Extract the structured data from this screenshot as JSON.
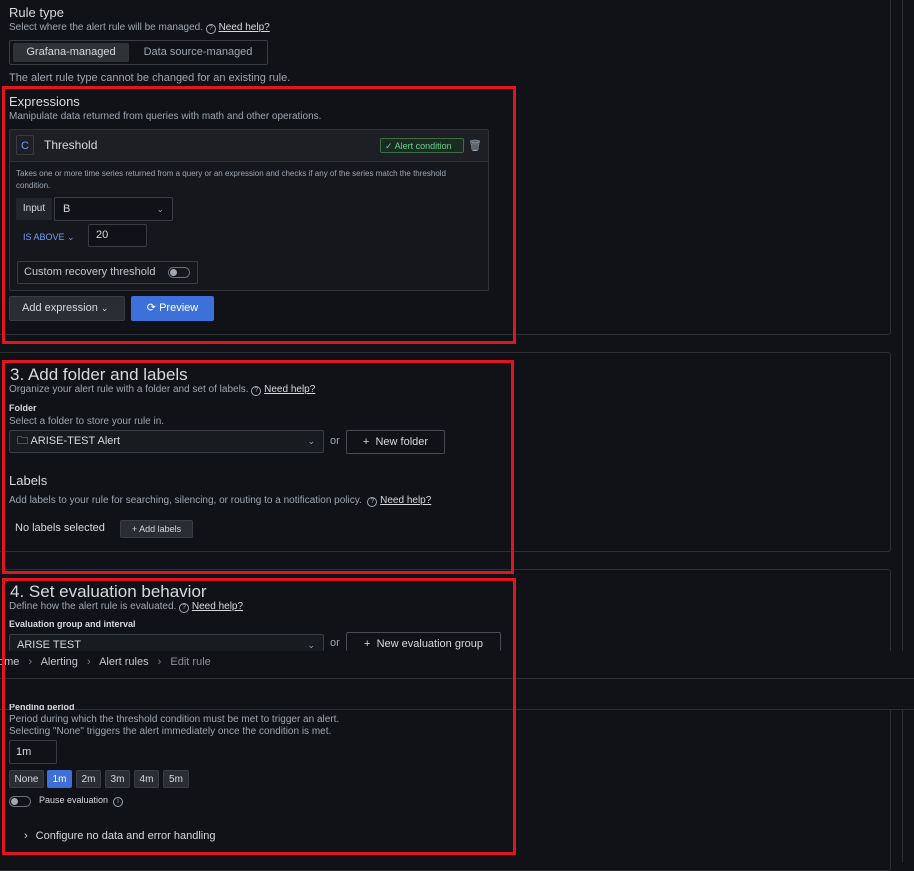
{
  "rule_type": {
    "title": "Rule type",
    "description": "Select where the alert rule will be managed.",
    "help": "Need help?",
    "options": [
      "Grafana-managed",
      "Data source-managed"
    ],
    "note": "The alert rule type cannot be changed for an existing rule."
  },
  "expressions": {
    "title": "Expressions",
    "description": "Manipulate data returned from queries with math and other operations.",
    "card": {
      "ref": "C",
      "name": "Threshold",
      "alert_badge": "Alert condition",
      "description": "Takes one or more time series returned from a query or an expression and checks if any of the series match the threshold condition.",
      "input_label": "Input",
      "input_value": "B",
      "operator": "IS ABOVE",
      "threshold": "20",
      "recovery_label": "Custom recovery threshold"
    },
    "add_expression": "Add expression",
    "preview": "Preview"
  },
  "folder_section": {
    "title": "3. Add folder and labels",
    "description": "Organize your alert rule with a folder and set of labels.",
    "help": "Need help?",
    "folder_label": "Folder",
    "folder_desc": "Select a folder to store your rule in.",
    "folder_value": "ARISE-TEST Alert",
    "or": "or",
    "new_folder": "New folder",
    "labels_title": "Labels",
    "labels_desc": "Add labels to your rule for searching, silencing, or routing to a notification policy.",
    "labels_help": "Need help?",
    "no_labels": "No labels selected",
    "add_labels": "Add labels"
  },
  "evaluation": {
    "title": "4. Set evaluation behavior",
    "description": "Define how the alert rule is evaluated.",
    "help": "Need help?",
    "group_label": "Evaluation group and interval",
    "group_value": "ARISE TEST",
    "or": "or",
    "new_group": "New evaluation group",
    "pending_label": "Pending period",
    "pending_desc1": "Period during which the threshold condition must be met to trigger an alert.",
    "pending_desc2": "Selecting \"None\" triggers the alert immediately once the condition is met.",
    "pending_value": "1m",
    "options": [
      "None",
      "1m",
      "2m",
      "3m",
      "4m",
      "5m"
    ],
    "selected": "1m",
    "pause_label": "Pause evaluation",
    "configure_label": "Configure no data and error handling"
  },
  "breadcrumb": [
    "ome",
    "Alerting",
    "Alert rules",
    "Edit rule"
  ],
  "colors": {
    "background": "#111217",
    "accent": "#3d71d9",
    "alert_green": "#6ccf8e",
    "highlight_red": "#e0161e"
  }
}
